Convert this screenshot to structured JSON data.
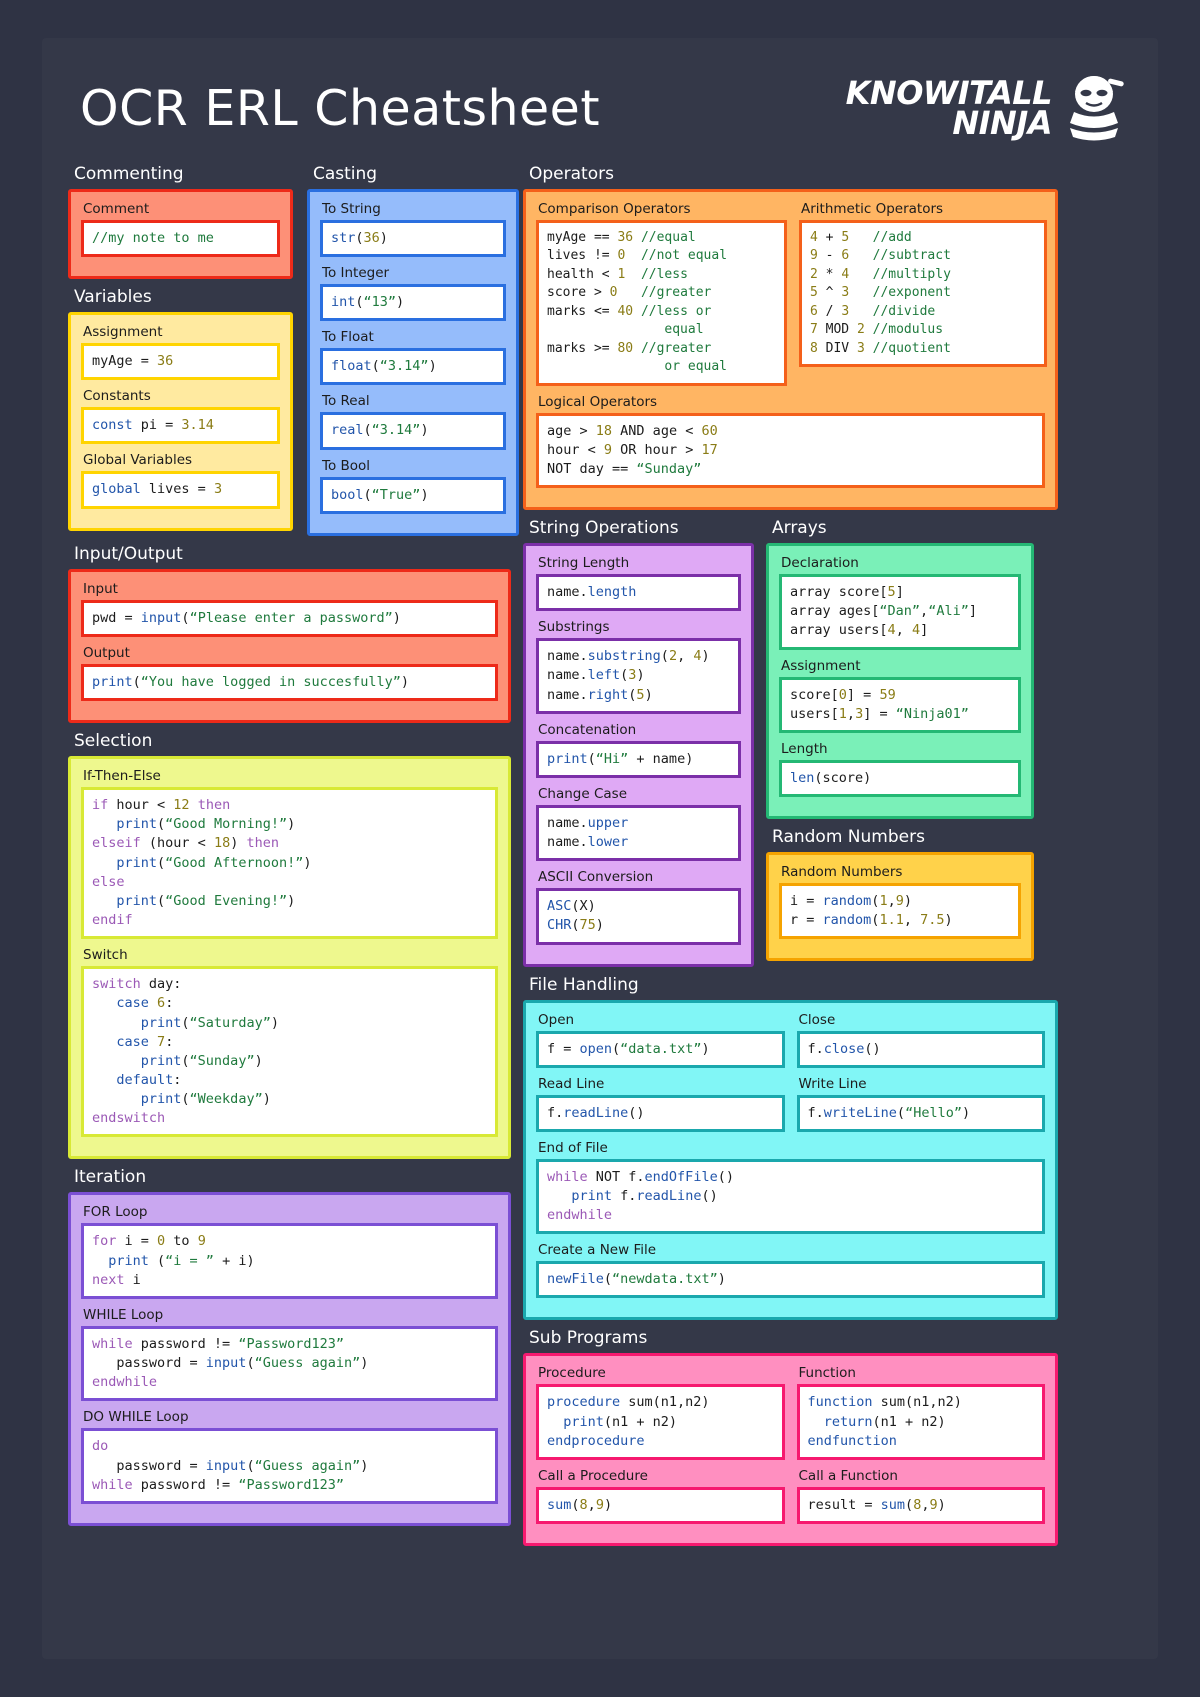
{
  "header": {
    "title": "OCR ERL Cheatsheet",
    "logo_line1": "KNOWITALL",
    "logo_line2": "NINJA",
    "logo_icon": "ninja-mascot-icon"
  },
  "sections": {
    "commenting": {
      "title": "Commenting",
      "comment_label": "Comment",
      "comment_code": "//my note to me"
    },
    "variables": {
      "title": "Variables",
      "assignment_label": "Assignment",
      "assignment_code": "myAge = 36",
      "constants_label": "Constants",
      "constants_code": "const pi = 3.14",
      "global_label": "Global Variables",
      "global_code": "global lives = 3"
    },
    "casting": {
      "title": "Casting",
      "to_string_label": "To String",
      "to_string_code": "str(36)",
      "to_integer_label": "To Integer",
      "to_integer_code": "int(“13”)",
      "to_float_label": "To Float",
      "to_float_code": "float(“3.14”)",
      "to_real_label": "To Real",
      "to_real_code": "real(“3.14”)",
      "to_bool_label": "To Bool",
      "to_bool_code": "bool(“True”)"
    },
    "input_output": {
      "title": "Input/Output",
      "input_label": "Input",
      "input_code": "pwd = input(“Please enter a password”)",
      "output_label": "Output",
      "output_code": "print(“You have logged in succesfully”)"
    },
    "operators": {
      "title": "Operators",
      "comparison_label": "Comparison Operators",
      "comparison_code": "myAge == 36 //equal\nlives != 0  //not equal\nhealth < 1  //less\nscore > 0   //greater\nmarks <= 40 //less or\n               equal\nmarks >= 80 //greater\n               or equal",
      "arithmetic_label": "Arithmetic Operators",
      "arithmetic_code": "4 + 5   //add\n9 - 6   //subtract\n2 * 4   //multiply\n5 ^ 3   //exponent\n6 / 3   //divide\n7 MOD 2 //modulus\n8 DIV 3 //quotient",
      "logical_label": "Logical Operators",
      "logical_code": "age > 18 AND age < 60\nhour < 9 OR hour > 17\nNOT day == “Sunday”"
    },
    "selection": {
      "title": "Selection",
      "if_label": "If-Then-Else",
      "if_code": "if hour < 12 then\n   print(“Good Morning!”)\nelseif (hour < 18) then\n   print(“Good Afternoon!”)\nelse\n   print(“Good Evening!”)\nendif",
      "switch_label": "Switch",
      "switch_code": "switch day:\n   case 6:\n      print(“Saturday”)\n   case 7:\n      print(“Sunday”)\n   default:\n      print(“Weekday”)\nendswitch"
    },
    "iteration": {
      "title": "Iteration",
      "for_label": "FOR Loop",
      "for_code": "for i = 0 to 9\n  print (“i = ” + i)\nnext i",
      "while_label": "WHILE Loop",
      "while_code": "while password != “Password123”\n   password = input(“Guess again”)\nendwhile",
      "dowhile_label": "DO WHILE Loop",
      "dowhile_code": "do\n   password = input(“Guess again”)\nwhile password != “Password123”"
    },
    "string_operations": {
      "title": "String Operations",
      "length_label": "String Length",
      "length_code": "name.length",
      "substrings_label": "Substrings",
      "substrings_code": "name.substring(2, 4)\nname.left(3)\nname.right(5)",
      "concat_label": "Concatenation",
      "concat_code": "print(“Hi” + name)",
      "case_label": "Change Case",
      "case_code": "name.upper\nname.lower",
      "ascii_label": "ASCII Conversion",
      "ascii_code": "ASC(X)\nCHR(75)"
    },
    "arrays": {
      "title": "Arrays",
      "declaration_label": "Declaration",
      "declaration_code": "array score[5]\narray ages[“Dan”,“Ali”]\narray users[4, 4]",
      "assignment_label": "Assignment",
      "assignment_code": "score[0] = 59\nusers[1,3] = “Ninja01”",
      "length_label": "Length",
      "length_code": "len(score)"
    },
    "random_numbers": {
      "title": "Random Numbers",
      "label": "Random Numbers",
      "code": "i = random(1,9)\nr = random(1.1, 7.5)"
    },
    "file_handling": {
      "title": "File Handling",
      "open_label": "Open",
      "open_code": "f = open(“data.txt”)",
      "close_label": "Close",
      "close_code": "f.close()",
      "read_label": "Read Line",
      "read_code": "f.readLine()",
      "write_label": "Write Line",
      "write_code": "f.writeLine(“Hello”)",
      "eof_label": "End of File",
      "eof_code": "while NOT f.endOfFile()\n   print f.readLine()\nendwhile",
      "newfile_label": "Create a New File",
      "newfile_code": "newFile(“newdata.txt”)"
    },
    "sub_programs": {
      "title": "Sub Programs",
      "procedure_label": "Procedure",
      "procedure_code": "procedure sum(n1,n2)\n  print(n1 + n2)\nendprocedure",
      "function_label": "Function",
      "function_code": "function sum(n1,n2)\n  return(n1 + n2)\nendfunction",
      "call_procedure_label": "Call a Procedure",
      "call_procedure_code": "sum(8,9)",
      "call_function_label": "Call a Function",
      "call_function_code": "result = sum(8,9)"
    }
  },
  "colors": {
    "page_bg": "#2f3344",
    "sheet_bg": "#343848",
    "red": "#ed2a19",
    "yellow": "#ffd400",
    "blue": "#2a6fe0",
    "orange": "#f4601a",
    "lime": "#d8e935",
    "violet": "#7b4fd4",
    "purple": "#7b2fa8",
    "green": "#24b874",
    "gold": "#f5a300",
    "cyan": "#1aa8ad",
    "pink": "#f6196f",
    "token_keyword": "#9b59b6",
    "token_function": "#2255aa",
    "token_string": "#1f7a3d",
    "token_number": "#8a7c16",
    "token_comment": "#1f7a3d"
  }
}
